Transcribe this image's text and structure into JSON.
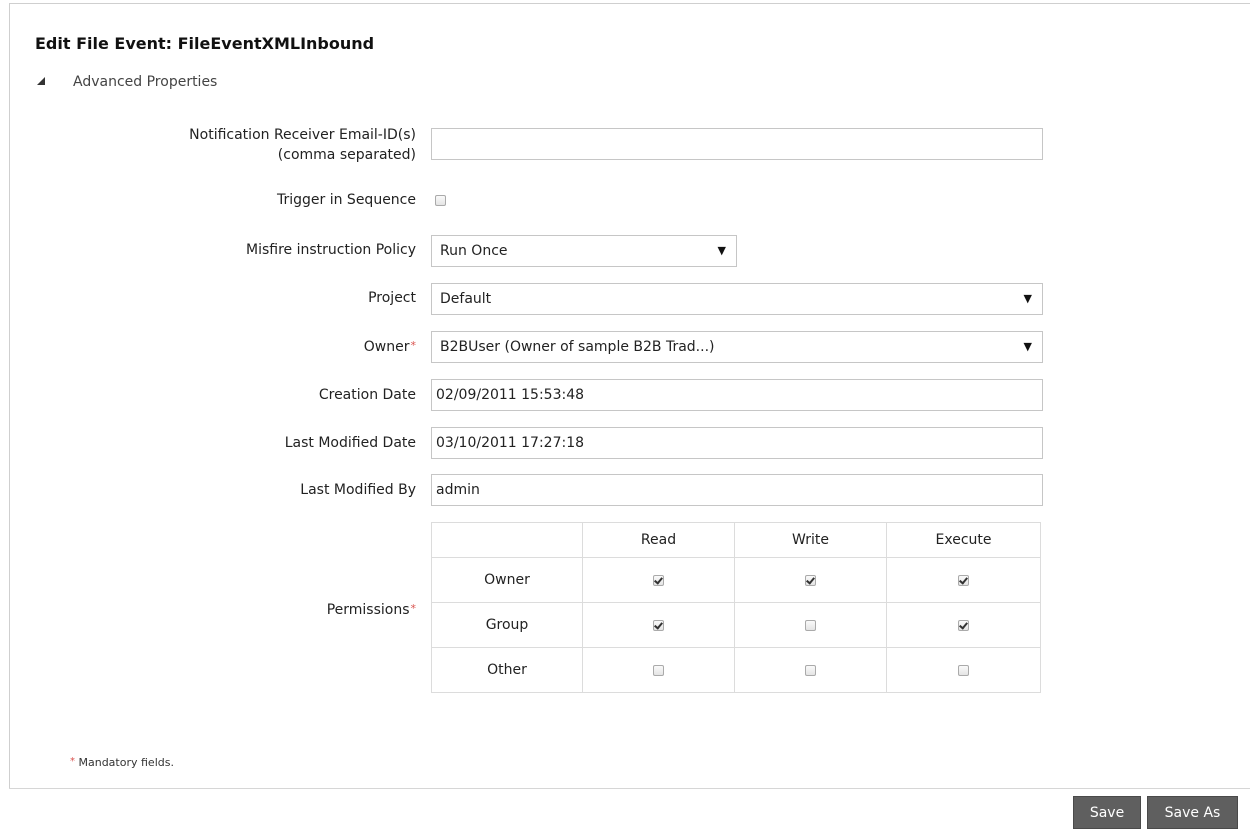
{
  "page_title": "Edit File Event: FileEventXMLInbound",
  "section_label": "Advanced Properties",
  "fields": {
    "notification": {
      "label_line1": "Notification Receiver Email-ID(s)",
      "label_line2": "(comma separated)",
      "value": ""
    },
    "trigger_in_sequence": {
      "label": "Trigger in Sequence",
      "checked": false
    },
    "misfire_policy": {
      "label": "Misfire instruction Policy",
      "value": "Run Once"
    },
    "project": {
      "label": "Project",
      "value": "Default"
    },
    "owner": {
      "label": "Owner",
      "required_mark": "*",
      "value": "B2BUser (Owner of sample B2B Trad...)"
    },
    "creation_date": {
      "label": "Creation Date",
      "value": "02/09/2011 15:53:48"
    },
    "last_modified_date": {
      "label": "Last Modified Date",
      "value": "03/10/2011 17:27:18"
    },
    "last_modified_by": {
      "label": "Last Modified By",
      "value": "admin"
    }
  },
  "permissions": {
    "label": "Permissions",
    "required_mark": "*",
    "columns": [
      "Read",
      "Write",
      "Execute"
    ],
    "rows": [
      {
        "name": "Owner",
        "values": [
          true,
          true,
          true
        ]
      },
      {
        "name": "Group",
        "values": [
          true,
          false,
          true
        ]
      },
      {
        "name": "Other",
        "values": [
          false,
          false,
          false
        ]
      }
    ]
  },
  "mandatory_note": {
    "mark": "*",
    "text": " Mandatory fields."
  },
  "buttons": {
    "save": "Save",
    "save_as": "Save As"
  }
}
